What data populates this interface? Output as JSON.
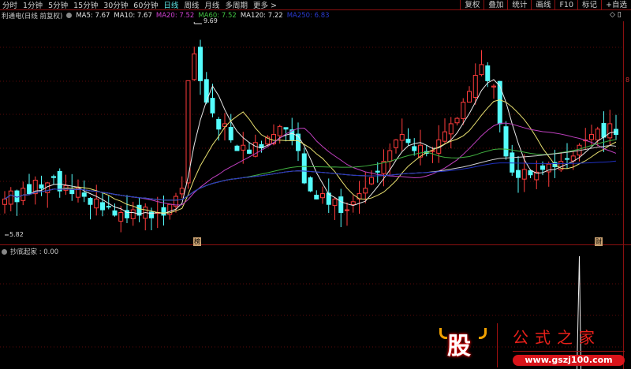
{
  "periods": [
    "分时",
    "1分钟",
    "5分钟",
    "15分钟",
    "30分钟",
    "60分钟",
    "日线",
    "周线",
    "月线",
    "多周期",
    "更多 >"
  ],
  "active_period": "日线",
  "right_buttons": [
    "复权",
    "叠加",
    "统计",
    "画线",
    "F10",
    "标记",
    "+自选"
  ],
  "info": {
    "title": "利通电(日线 前复权)",
    "ma": [
      {
        "label": "MA5: 7.67",
        "color": "#e0e0e0"
      },
      {
        "label": "MA10: 7.67",
        "color": "#e0e0e0"
      },
      {
        "label": "MA20: 7.52",
        "color": "#d040d0"
      },
      {
        "label": "MA60: 7.52",
        "color": "#40c040"
      },
      {
        "label": "MA120: 7.22",
        "color": "#e0e0e0"
      },
      {
        "label": "MA250: 6.83",
        "color": "#2a3ad0"
      }
    ]
  },
  "high_marker": "9.69",
  "low_marker": "5.82",
  "axis_label": "8",
  "tags": [
    "榜",
    "财"
  ],
  "indicator": {
    "label": "抄底起家 : 0.00",
    "spike_index": 94,
    "spike_value": 1
  },
  "watermark": {
    "logo": "股",
    "name": "公式之家",
    "url": "www.gszj100.com"
  },
  "colors": {
    "up": "#ff3c3c",
    "down": "#54fcfc",
    "ma5": "#e8e8e8",
    "ma10": "#e8e070",
    "ma20": "#c040c0",
    "ma60": "#40b040",
    "ma120": "#d0d0d0",
    "ma250": "#2030c0"
  },
  "chart_data": {
    "type": "candlestick",
    "price_range": [
      5.82,
      9.69
    ],
    "closes": [
      6.4,
      6.55,
      6.35,
      6.6,
      6.5,
      6.75,
      6.6,
      6.7,
      6.8,
      6.55,
      6.65,
      6.5,
      6.6,
      6.45,
      6.3,
      6.4,
      6.2,
      6.25,
      6.1,
      6.15,
      6.05,
      6.2,
      6.1,
      6.25,
      6.05,
      6.15,
      6.1,
      6.3,
      6.45,
      6.6,
      8.6,
      9.1,
      8.6,
      8.2,
      8.0,
      7.7,
      7.8,
      7.5,
      7.3,
      7.4,
      7.25,
      7.45,
      7.35,
      7.55,
      7.6,
      7.75,
      7.7,
      7.5,
      7.3,
      6.7,
      6.55,
      6.4,
      6.5,
      6.3,
      6.4,
      6.15,
      6.2,
      6.35,
      6.5,
      6.6,
      6.8,
      6.9,
      7.1,
      7.3,
      7.5,
      7.6,
      7.45,
      7.3,
      7.4,
      7.25,
      7.3,
      7.5,
      7.65,
      7.8,
      7.9,
      8.2,
      8.4,
      8.7,
      8.9,
      8.6,
      8.5,
      7.8,
      7.2,
      6.9,
      6.8,
      6.95,
      6.85,
      6.9,
      6.95,
      7.05,
      7.0,
      7.1,
      7.15,
      7.2,
      7.4,
      7.5,
      7.6,
      7.7,
      7.55,
      7.8,
      7.6
    ]
  }
}
